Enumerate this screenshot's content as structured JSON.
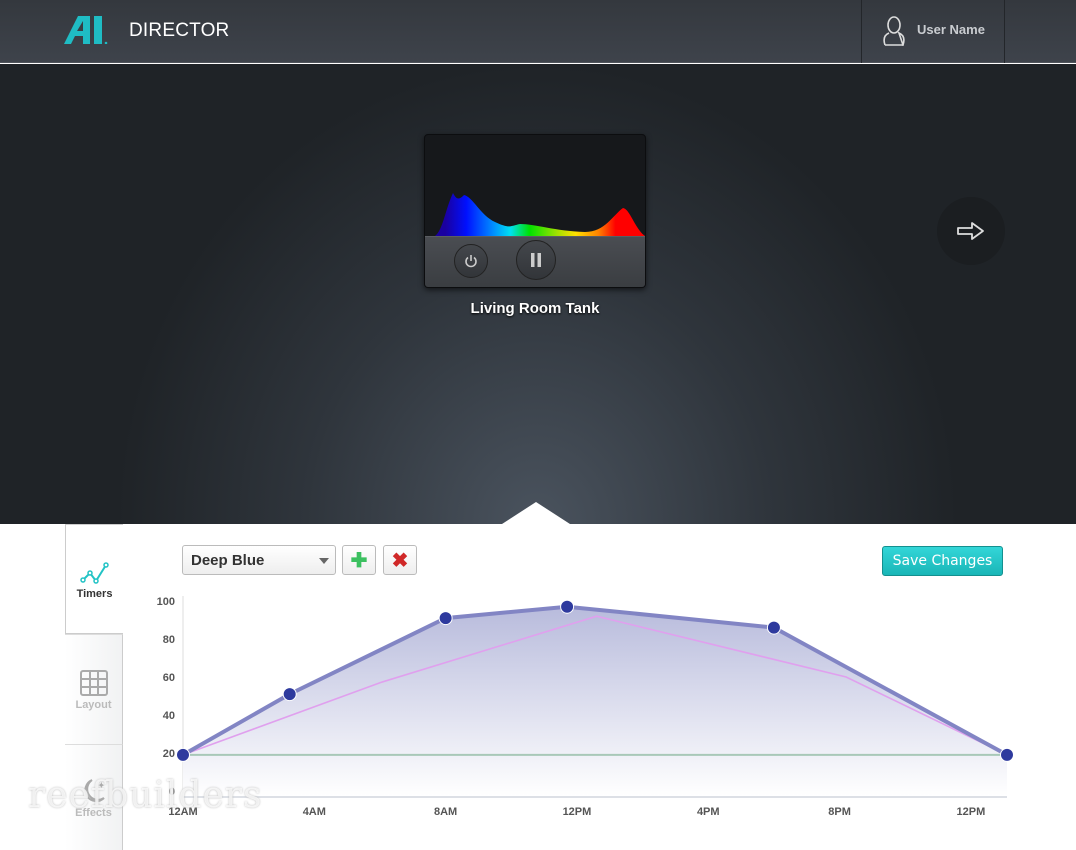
{
  "header": {
    "brand": "DIRECTOR",
    "user_name": "User Name",
    "logo_text": "AI"
  },
  "device": {
    "name": "Living Room Tank"
  },
  "tabs": [
    {
      "label": "Timers"
    },
    {
      "label": "Layout"
    },
    {
      "label": "Effects"
    }
  ],
  "toolbar": {
    "channel": "Deep Blue",
    "save_label": "Save Changes"
  },
  "watermark": "reefbuilders",
  "colors": {
    "accent": "#22c3c5",
    "series": "#2e3a9e",
    "secondary": "#e0a0ee",
    "baseline": "#a8c8b8"
  },
  "chart_data": {
    "type": "area",
    "xlim": [
      0,
      25.1
    ],
    "ylim": [
      0,
      100
    ],
    "x_ticks": [
      {
        "v": 0,
        "label": "12AM"
      },
      {
        "v": 4,
        "label": "4AM"
      },
      {
        "v": 8,
        "label": "8AM"
      },
      {
        "v": 12,
        "label": "12PM"
      },
      {
        "v": 16,
        "label": "4PM"
      },
      {
        "v": 20,
        "label": "8PM"
      },
      {
        "v": 24,
        "label": "12PM"
      }
    ],
    "y_ticks": [
      0,
      20,
      40,
      60,
      80,
      100
    ],
    "series": [
      {
        "x": [
          0,
          3.25,
          8,
          11.7,
          18,
          25.1
        ],
        "y": [
          19,
          51,
          91,
          97,
          86,
          19
        ]
      },
      {
        "x": [
          0,
          6,
          12.6,
          20.2,
          25.1
        ],
        "y": [
          19,
          57,
          92,
          60,
          19
        ]
      },
      {
        "x": [
          0,
          25.1
        ],
        "y": [
          19,
          19
        ]
      }
    ]
  }
}
